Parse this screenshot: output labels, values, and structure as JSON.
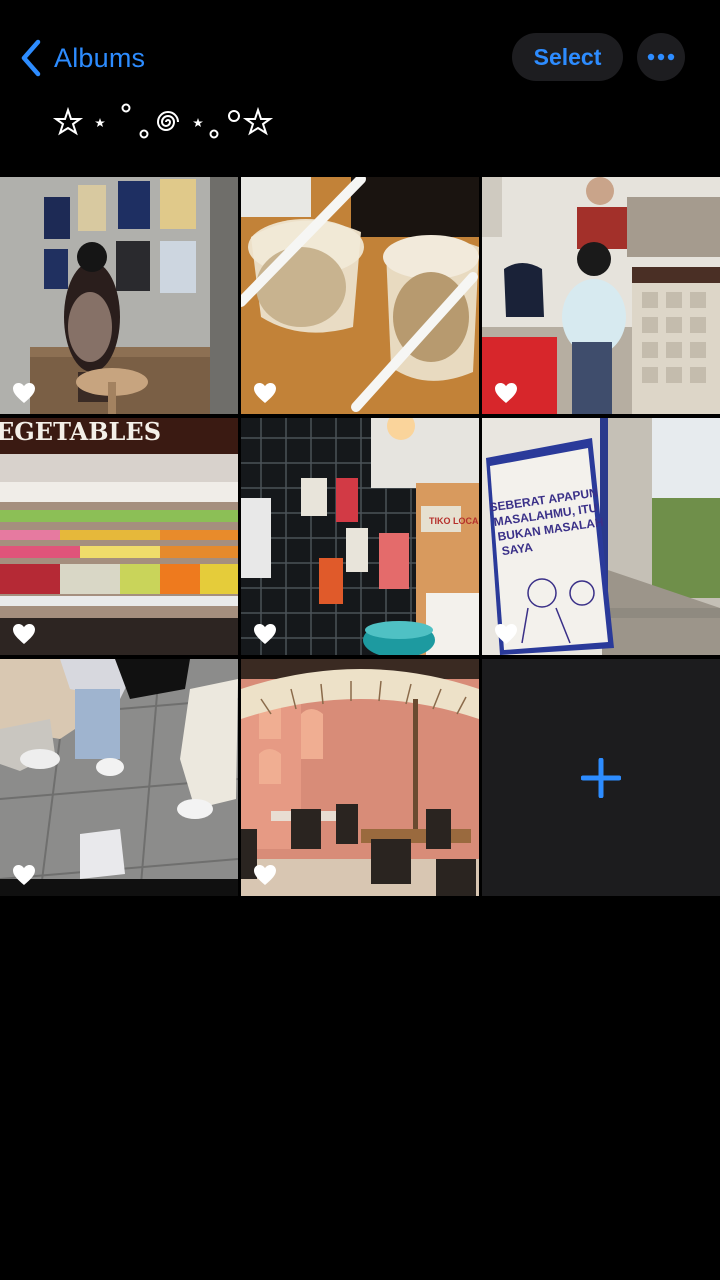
{
  "nav": {
    "back_label": "Albums",
    "select_label": "Select"
  },
  "colors": {
    "accent": "#2d8cff",
    "background": "#000000",
    "button_bg": "#1d1d20"
  },
  "photos": [
    {
      "desc": "gallery-wall"
    },
    {
      "desc": "iced-drinks"
    },
    {
      "desc": "cafe-counter"
    },
    {
      "desc": "vegetables-shelf",
      "sign_text": "EGETABLES"
    },
    {
      "desc": "tile-wall-posters",
      "sign_text": "TIKO LOCAL"
    },
    {
      "desc": "poster-sign",
      "sign_text": "SEBERAT APAPUN MASALAHMU, ITU BUKAN MASALAH SAYA"
    },
    {
      "desc": "feet-floor"
    },
    {
      "desc": "pink-restaurant"
    }
  ],
  "add_icon": "plus-icon"
}
